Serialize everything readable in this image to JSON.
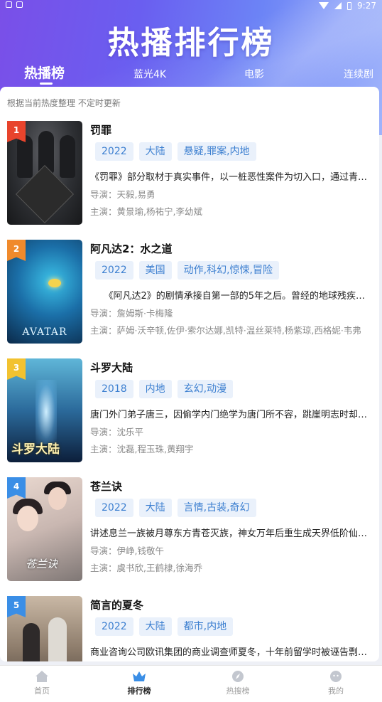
{
  "status_bar": {
    "time": "9:27"
  },
  "header": {
    "title": "热播排行榜",
    "tabs": [
      {
        "label": "热播榜",
        "active": true
      },
      {
        "label": "蓝光4K",
        "active": false
      },
      {
        "label": "电影",
        "active": false
      },
      {
        "label": "连续剧",
        "active": false
      }
    ]
  },
  "list": {
    "subtitle": "根据当前热度整理 不定时更新",
    "items": [
      {
        "rank": "1",
        "rank_color": "#e8442c",
        "title": "罚罪",
        "tags": [
          "2022",
          "大陆",
          "悬疑,罪案,内地"
        ],
        "description": "《罚罪》部分取材于真实事件，以一桩恶性案件为切入口，通过青年刑警常征和嫌犯李青……",
        "director": "导演：天毅,易勇",
        "cast": "主演：黄景瑜,杨祐宁,李幼斌"
      },
      {
        "rank": "2",
        "rank_color": "#f08a2c",
        "title": "阿凡达2：水之道",
        "tags": [
          "2022",
          "美国",
          "动作,科幻,惊悚,冒险"
        ],
        "description": "　　《阿凡达2》的剧情承接自第一部的5年之后。曾经的地球残疾军人杰克·萨利……",
        "director": "导演：詹姆斯·卡梅隆",
        "cast": "主演：萨姆·沃辛顿,佐伊·索尔达娜,凯特·温丝莱特,杨紫琼,西格妮·韦弗",
        "poster_text": "AVATAR"
      },
      {
        "rank": "3",
        "rank_color": "#f2c230",
        "title": "斗罗大陆",
        "tags": [
          "2018",
          "内地",
          "玄幻,动漫"
        ],
        "description": "唐门外门弟子唐三，因偷学内门绝学为唐门所不容，跳崖明志时却发现没有死……",
        "director": "导演：沈乐平",
        "cast": "主演：沈磊,程玉珠,黄翔宇",
        "poster_text": "斗罗大陆"
      },
      {
        "rank": "4",
        "rank_color": "#3a8ee6",
        "title": "苍兰诀",
        "tags": [
          "2022",
          "大陆",
          "言情,古装,奇幻"
        ],
        "description": "讲述息兰一族被月尊东方青苍灭族，神女万年后重生成天界低阶仙女小兰花……",
        "director": "导演：伊峥,钱敬午",
        "cast": "主演：虞书欣,王鹤棣,徐海乔",
        "poster_text": "苍兰诀"
      },
      {
        "rank": "5",
        "rank_color": "#3a8ee6",
        "title": "简言的夏冬",
        "tags": [
          "2022",
          "大陆",
          "都市,内地"
        ],
        "description": "商业咨询公司欧讯集团的商业调查师夏冬，十年前留学时被诬告剽窃……",
        "director": "",
        "cast": ""
      }
    ]
  },
  "bottom_nav": [
    {
      "label": "首页",
      "icon": "home-icon",
      "active": false
    },
    {
      "label": "排行榜",
      "icon": "crown-icon",
      "active": true
    },
    {
      "label": "热搜榜",
      "icon": "compass-icon",
      "active": false
    },
    {
      "label": "我的",
      "icon": "profile-icon",
      "active": false
    }
  ],
  "colors": {
    "accent_blue": "#3c7fd0",
    "tag_bg": "#eaf1fb",
    "header_start": "#7a4fe8",
    "header_end": "#9fb3fb"
  }
}
